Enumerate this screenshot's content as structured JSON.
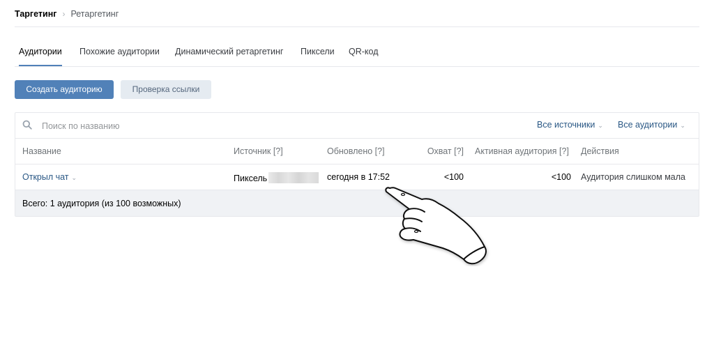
{
  "breadcrumb": {
    "root": "Таргетинг",
    "separator": "›",
    "current": "Ретаргетинг"
  },
  "tabs": [
    {
      "label": "Аудитории",
      "active": true
    },
    {
      "label": "Похожие аудитории",
      "active": false
    },
    {
      "label": "Динамический ретаргетинг",
      "active": false
    },
    {
      "label": "Пиксели",
      "active": false
    },
    {
      "label": "QR-код",
      "active": false
    }
  ],
  "actions": {
    "create_label": "Создать аудиторию",
    "check_link_label": "Проверка ссылки"
  },
  "search": {
    "placeholder": "Поиск по названию",
    "icon": "search-icon"
  },
  "filters": {
    "sources_label": "Все источники",
    "audiences_label": "Все аудитории"
  },
  "table": {
    "columns": [
      "Название",
      "Источник [?]",
      "Обновлено [?]",
      "Охват [?]",
      "Активная аудитория [?]",
      "Действия"
    ],
    "rows": [
      {
        "name": "Открыл чат",
        "source": "Пиксель",
        "updated": "сегодня в 17:52",
        "reach": "<100",
        "active_audience": "<100",
        "action": "Аудитория слишком мала"
      }
    ],
    "footer": "Всего: 1 аудитория (из 100 возможных)"
  },
  "colors": {
    "accent": "#5181b8",
    "link": "#2a5885",
    "secondary_button_bg": "#e5ebf1",
    "border": "#e7e8ec",
    "footer_bg": "#f0f2f5"
  },
  "overlay": {
    "icon": "pointing-hand-icon"
  }
}
